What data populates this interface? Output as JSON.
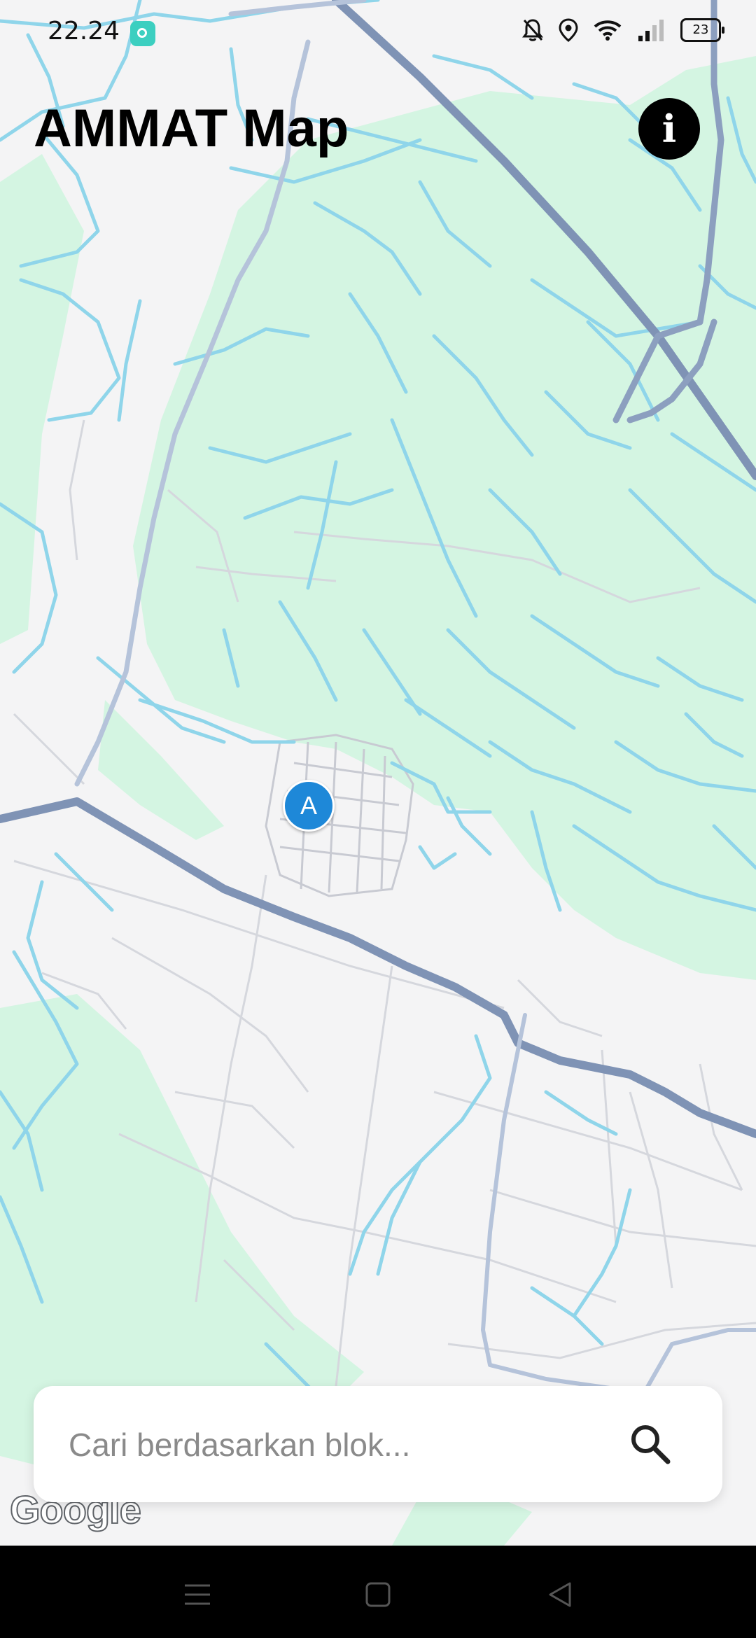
{
  "status_bar": {
    "time": "22.24",
    "battery": "23",
    "icons": [
      "app-notification-icon",
      "mute-bell-icon",
      "location-icon",
      "wifi-icon",
      "signal-icon",
      "battery-icon"
    ]
  },
  "header": {
    "title": "AMMAT Map",
    "info_icon": "info-icon"
  },
  "map": {
    "marker_label": "A",
    "attribution": "Google",
    "colors": {
      "background": "#f4f4f5",
      "park": "#d4f5e2",
      "water": "#8fd5ea",
      "highway": "#8c9fbf",
      "minor_road": "#d6d8de"
    }
  },
  "search": {
    "placeholder": "Cari berdasarkan blok...",
    "value": "",
    "icon": "search-icon"
  },
  "nav_bar": {
    "buttons": [
      "menu-icon",
      "home-icon",
      "back-icon"
    ]
  }
}
